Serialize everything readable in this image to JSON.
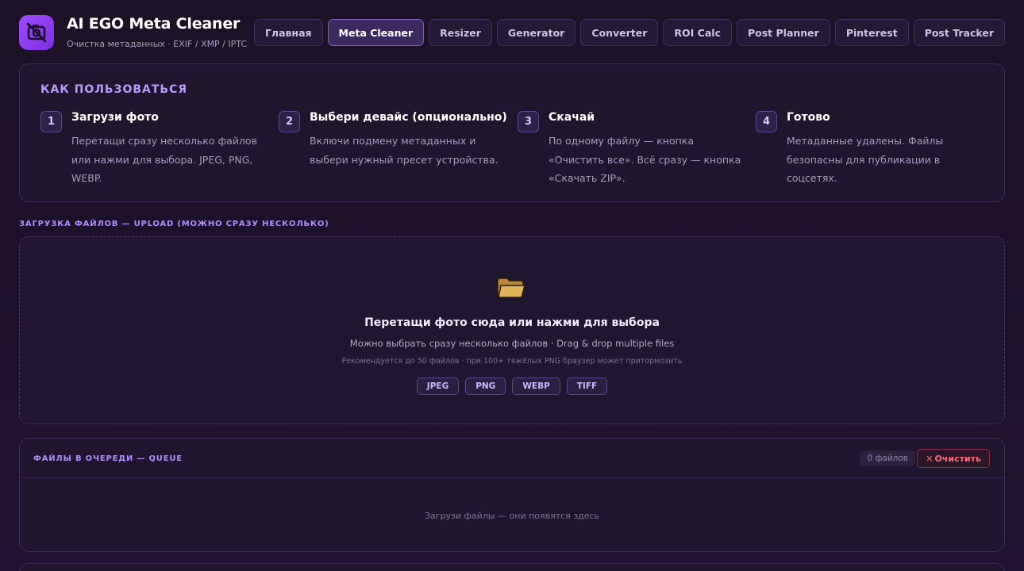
{
  "header": {
    "title": "AI EGO Meta Cleaner",
    "subtitle": "Очистка метаданных · EXIF / XMP / IPTC",
    "logo_icon": "camera-off-icon",
    "accent": "#8b3dff"
  },
  "nav": [
    {
      "label": "Главная",
      "active": false
    },
    {
      "label": "Meta Cleaner",
      "active": true
    },
    {
      "label": "Resizer",
      "active": false
    },
    {
      "label": "Generator",
      "active": false
    },
    {
      "label": "Converter",
      "active": false
    },
    {
      "label": "ROI Calc",
      "active": false
    },
    {
      "label": "Post Planner",
      "active": false
    },
    {
      "label": "Pinterest",
      "active": false
    },
    {
      "label": "Post Tracker",
      "active": false
    }
  ],
  "howto": {
    "title": "КАК ПОЛЬЗОВАТЬСЯ",
    "steps": [
      {
        "num": "1",
        "title": "Загрузи фото",
        "desc": "Перетащи сразу несколько файлов или нажми для выбора. JPEG, PNG, WEBP."
      },
      {
        "num": "2",
        "title": "Выбери девайс (опционально)",
        "desc": "Включи подмену метаданных и выбери нужный пресет устройства."
      },
      {
        "num": "3",
        "title": "Скачай",
        "desc": "По одному файлу — кнопка «Очистить все». Всё сразу — кнопка «Скачать ZIP»."
      },
      {
        "num": "4",
        "title": "Готово",
        "desc": "Метаданные удалены. Файлы безопасны для публикации в соцсетях."
      }
    ]
  },
  "upload": {
    "section_label": "ЗАГРУЗКА ФАЙЛОВ — UPLOAD (МОЖНО СРАЗУ НЕСКОЛЬКО)",
    "icon": "folder-icon",
    "title": "Перетащи фото сюда или нажми для выбора",
    "subtitle": "Можно выбрать сразу несколько файлов · Drag & drop multiple files",
    "note": "Рекомендуется до 50 файлов · при 100+ тяжёлых PNG браузер может притормозить",
    "formats": [
      "JPEG",
      "PNG",
      "WEBP",
      "TIFF"
    ]
  },
  "queue": {
    "label": "ФАЙЛЫ В ОЧЕРЕДИ — QUEUE",
    "count": "0 файлов",
    "clear_label": "Очистить",
    "clear_icon": "close-icon",
    "empty_text": "Загрузи файлы — они появятся здесь"
  }
}
